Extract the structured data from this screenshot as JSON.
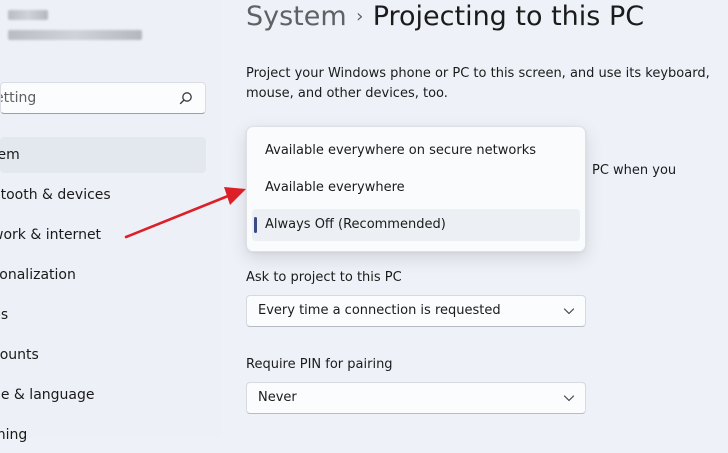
{
  "sidebar": {
    "search": {
      "value": "etting"
    },
    "items": [
      {
        "label": "tem"
      },
      {
        "label": "etooth & devices"
      },
      {
        "label": "work & internet"
      },
      {
        "label": "sonalization"
      },
      {
        "label": "ps"
      },
      {
        "label": "counts"
      },
      {
        "label": "ne & language"
      },
      {
        "label": "ming"
      }
    ]
  },
  "header": {
    "parent": "System",
    "separator": "›",
    "title": "Projecting to this PC"
  },
  "main": {
    "description": "Project your Windows phone or PC to this screen, and use its keyboard, mouse, and other devices, too.",
    "availability_trailing_text": "PC when you",
    "availability_options": [
      "Available everywhere on secure networks",
      "Available everywhere",
      "Always Off (Recommended)"
    ],
    "ask_label": "Ask to project to this PC",
    "ask_value": "Every time a connection is requested",
    "pin_label": "Require PIN for pairing",
    "pin_value": "Never"
  },
  "colors": {
    "background": "#eef2f8",
    "selection_indicator": "#3a4b86",
    "annotation_arrow": "#dd2027"
  },
  "icons": [
    "search-icon",
    "chevron-down-icon",
    "annotation-arrow"
  ]
}
